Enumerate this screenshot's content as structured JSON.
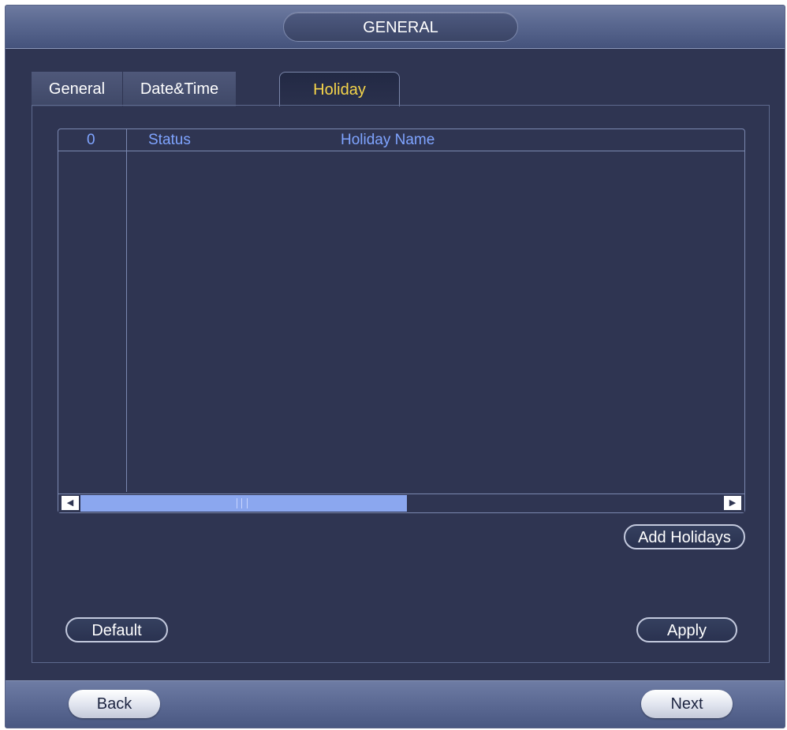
{
  "window": {
    "title": "GENERAL"
  },
  "tabs": [
    {
      "label": "General",
      "active": false
    },
    {
      "label": "Date&Time",
      "active": false
    },
    {
      "label": "Holiday",
      "active": true
    }
  ],
  "table": {
    "headers": {
      "index": "0",
      "status": "Status",
      "holiday_name": "Holiday Name"
    },
    "rows": [],
    "scroll": {
      "left_arrow": "◀",
      "right_arrow": "▶",
      "position_fraction": 0.0,
      "visible_fraction": 0.48
    }
  },
  "buttons": {
    "add_holidays": "Add Holidays",
    "default": "Default",
    "apply": "Apply"
  },
  "nav": {
    "back": "Back",
    "next": "Next"
  },
  "colors": {
    "background": "#2f3552",
    "active_tab_text": "#f5d54a",
    "table_header_text": "#7fa4ff",
    "scroll_thumb": "#8ba7ef"
  }
}
